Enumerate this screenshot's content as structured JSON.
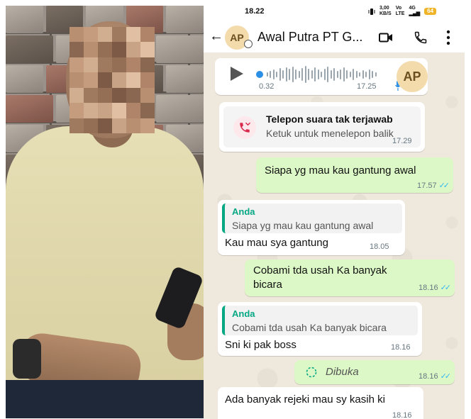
{
  "status_bar": {
    "time": "18.22",
    "net_speed": "3,00",
    "net_unit": "KB/S",
    "volte": "Vo",
    "lte": "LTE",
    "signal_label": "4G",
    "battery": "64"
  },
  "header": {
    "avatar_initials": "AP",
    "contact_name": "Awal Putra PT G..."
  },
  "voice_note": {
    "duration": "0.32",
    "time": "17.25",
    "avatar_initials": "AP"
  },
  "missed_call": {
    "title": "Telepon suara tak terjawab",
    "subtitle": "Ketuk untuk menelepon balik",
    "time": "17.29"
  },
  "messages": [
    {
      "direction": "out",
      "text": "Siapa yg mau kau gantung awal",
      "time": "17.57"
    },
    {
      "direction": "in",
      "quote_author": "Anda",
      "quote_text": "Siapa yg mau kau gantung awal",
      "text": "Kau mau sya gantung",
      "time": "18.05"
    },
    {
      "direction": "out",
      "text": "Cobami tda usah Ka banyak bicara",
      "time": "18.16"
    },
    {
      "direction": "in",
      "quote_author": "Anda",
      "quote_text": "Cobami tda usah Ka banyak bicara",
      "text": "Sni ki pak boss",
      "time": "18.16"
    },
    {
      "direction": "out",
      "text": "Dibuka",
      "time": "18.16"
    },
    {
      "direction": "in",
      "text": "Ada banyak rejeki mau sy kasih ki",
      "time": "18.16"
    }
  ],
  "colors": {
    "outgoing_bubble": "#dcf8c6",
    "incoming_bubble": "#ffffff",
    "quote_accent": "#06a884",
    "read_ticks": "#34b7f1",
    "chat_background": "#efe8dd",
    "avatar_bg": "#f3dbac"
  },
  "icons": {
    "back": "arrow-left-icon",
    "video": "video-camera-icon",
    "call": "phone-icon",
    "more": "more-vertical-icon",
    "play": "play-icon",
    "missed_call": "missed-call-icon",
    "view_once": "view-once-icon",
    "mic": "mic-icon",
    "read": "double-check-icon"
  }
}
